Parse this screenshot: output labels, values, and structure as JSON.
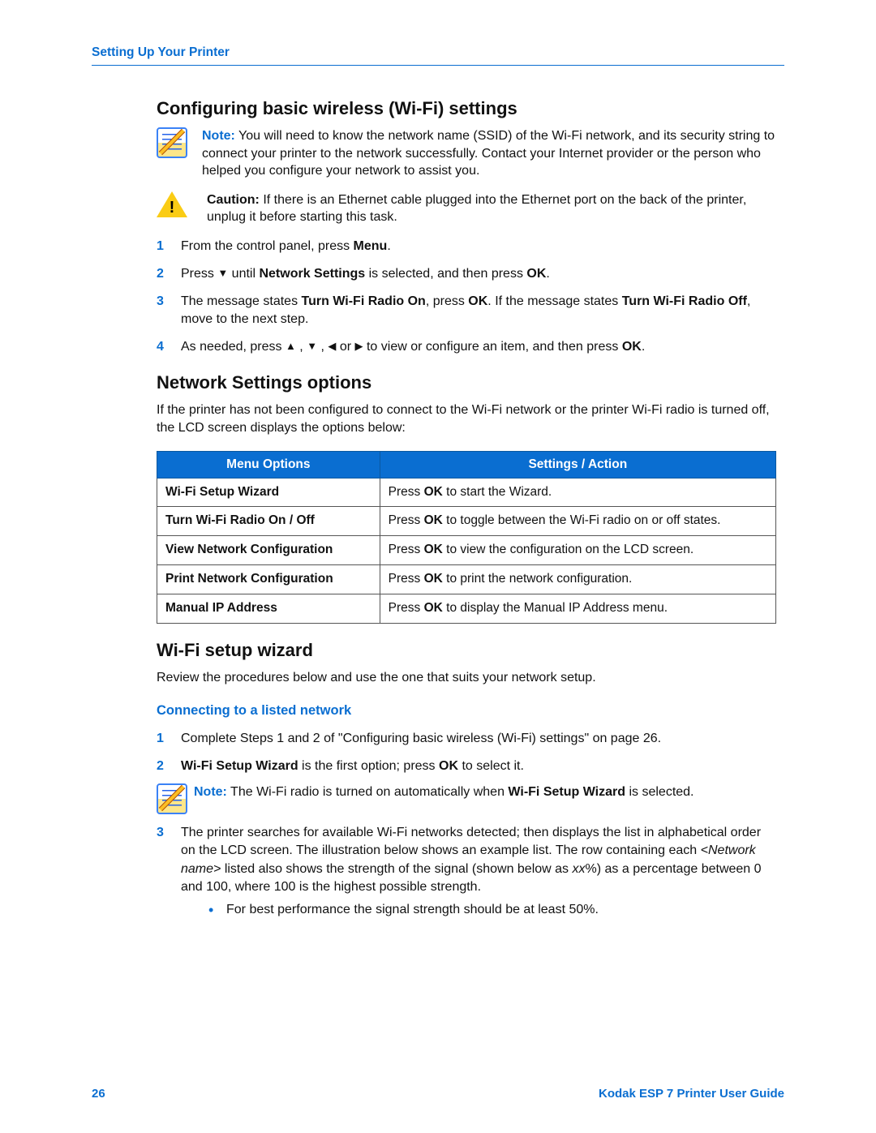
{
  "header": {
    "title": "Setting Up Your Printer"
  },
  "section1": {
    "heading": "Configuring basic wireless (Wi-Fi) settings",
    "note_prefix": "Note:",
    "note_text": " You will need to know the network name (SSID) of the Wi-Fi network, and its security string to connect your printer to the network successfully. Contact your Internet provider or the person who helped you configure your network to assist you.",
    "caution_prefix": "Caution:",
    "caution_text": " If there is an Ethernet cable plugged into the Ethernet port on the back of the printer, unplug it before starting this task.",
    "steps": {
      "s1_a": "From the control panel, press ",
      "s1_b": "Menu",
      "s1_c": ".",
      "s2_a": "Press ",
      "s2_b": " until ",
      "s2_c": "Network Settings",
      "s2_d": " is selected, and then press ",
      "s2_e": "OK",
      "s2_f": ".",
      "s3_a": "The message states ",
      "s3_b": "Turn Wi-Fi Radio On",
      "s3_c": ", press ",
      "s3_d": "OK",
      "s3_e": ". If the message states ",
      "s3_f": "Turn Wi-Fi Radio Off",
      "s3_g": ", move to the next step.",
      "s4_a": "As needed, press ",
      "s4_b": " , ",
      "s4_c": " , ",
      "s4_d": " or ",
      "s4_e": " to view or configure an item, and then press ",
      "s4_f": "OK",
      "s4_g": "."
    }
  },
  "section2": {
    "heading": "Network Settings options",
    "intro": "If the printer has not been configured to connect to the Wi-Fi network or the printer Wi-Fi radio is turned off, the LCD screen displays the options below:",
    "table": {
      "h1": "Menu Options",
      "h2": "Settings / Action",
      "rows": [
        {
          "opt": "Wi-Fi Setup Wizard",
          "a1": "Press ",
          "a2": "OK",
          "a3": " to start the Wizard."
        },
        {
          "opt": "Turn Wi-Fi Radio On / Off",
          "a1": "Press ",
          "a2": "OK",
          "a3": " to toggle between the Wi-Fi radio on or off states."
        },
        {
          "opt": "View Network Configuration",
          "a1": "Press ",
          "a2": "OK",
          "a3": " to view the configuration on the LCD screen."
        },
        {
          "opt": "Print Network Configuration",
          "a1": "Press ",
          "a2": "OK",
          "a3": " to print the network configuration."
        },
        {
          "opt": "Manual IP Address",
          "a1": "Press ",
          "a2": "OK",
          "a3": " to display the Manual IP Address menu."
        }
      ]
    }
  },
  "section3": {
    "heading": "Wi-Fi setup wizard",
    "intro": "Review the procedures below and use the one that suits your network setup.",
    "sub": "Connecting to a listed network",
    "steps": {
      "s1": "Complete Steps 1 and 2 of \"Configuring basic wireless (Wi-Fi) settings\" on page 26.",
      "s2_a": "Wi-Fi Setup Wizard",
      "s2_b": " is the first option; press ",
      "s2_c": "OK",
      "s2_d": " to select it.",
      "note_prefix": "Note:",
      "note_a": " The Wi-Fi radio is turned on automatically when ",
      "note_b": "Wi-Fi Setup Wizard",
      "note_c": " is selected.",
      "s3_a": "The printer searches for available Wi-Fi networks detected; then displays the list in alphabetical order on the LCD screen. The illustration below shows an example list. The row containing each ",
      "s3_b": "<Network name>",
      "s3_c": " listed also shows the strength of the signal (shown below as ",
      "s3_d": "xx",
      "s3_e": "%) as a percentage between 0 and 100, where 100 is the highest possible strength.",
      "bullet": "For best performance the signal strength should be at least 50%."
    }
  },
  "footer": {
    "page": "26",
    "guide": "Kodak ESP 7 Printer User Guide"
  }
}
